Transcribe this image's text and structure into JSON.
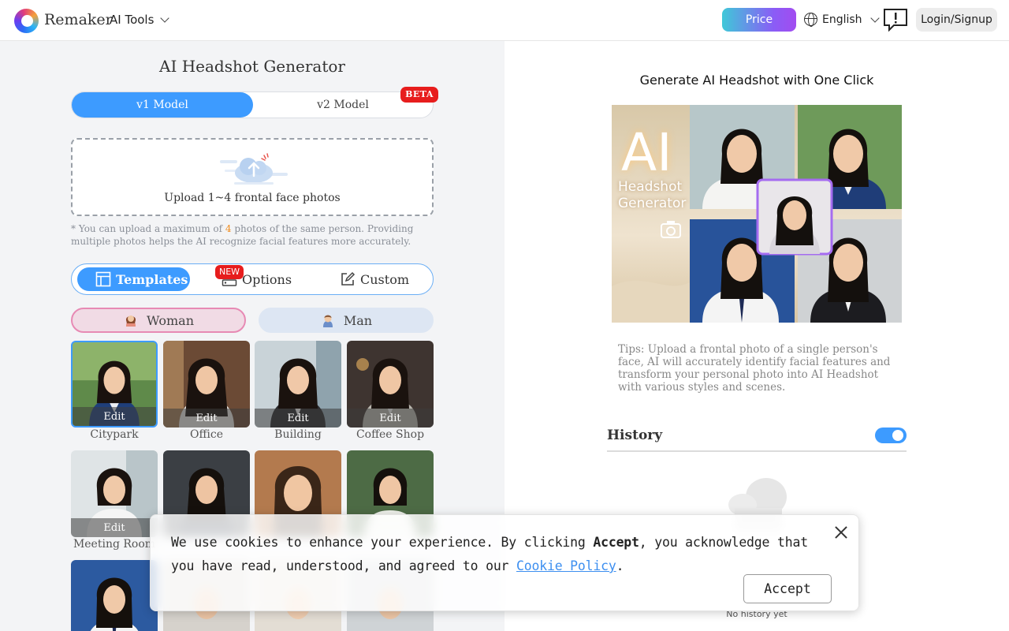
{
  "header": {
    "brand": "Remaker",
    "ai_tools": "AI Tools",
    "price": "Price",
    "language": "English",
    "login": "Login/Signup"
  },
  "left": {
    "title": "AI Headshot Generator",
    "models": [
      "v1 Model",
      "v2 Model"
    ],
    "beta": "BETA",
    "upload_text": "Upload 1~4 frontal face photos",
    "note_before": "* You can upload a maximum of ",
    "note_num": "4",
    "note_after": " photos of the same person. Providing multiple photos helps the AI recognize facial features more accurately.",
    "tabs": {
      "templates": "Templates",
      "options": "Options",
      "custom": "Custom"
    },
    "new_badge": "NEW",
    "gender": {
      "woman": "Woman",
      "man": "Man"
    },
    "edit_label": "Edit",
    "templates": [
      {
        "label": "Citypark"
      },
      {
        "label": "Office"
      },
      {
        "label": "Building"
      },
      {
        "label": "Coffee Shop"
      },
      {
        "label": "Meeting Room"
      }
    ]
  },
  "right": {
    "title": "Generate AI Headshot with One Click",
    "hero_big": "AI",
    "hero_line1": "Headshot",
    "hero_line2": "Generator",
    "tips": "Tips: Upload a frontal photo of a single person's face, AI will accurately identify facial features and transform your personal photo into AI Headshot with various styles and scenes.",
    "history_title": "History",
    "no_history": "No history yet"
  },
  "cookie": {
    "text1": "We use cookies to enhance your experience. By clicking ",
    "accept_word": "Accept",
    "text2": ", you acknowledge that you have read, understood, and agreed to our ",
    "link": "Cookie Policy",
    "text3": ".",
    "accept_button": "Accept"
  },
  "colors": {
    "accent": "#3d9bff",
    "badge_red": "#e71d1d",
    "woman_border": "#e78ab4"
  }
}
